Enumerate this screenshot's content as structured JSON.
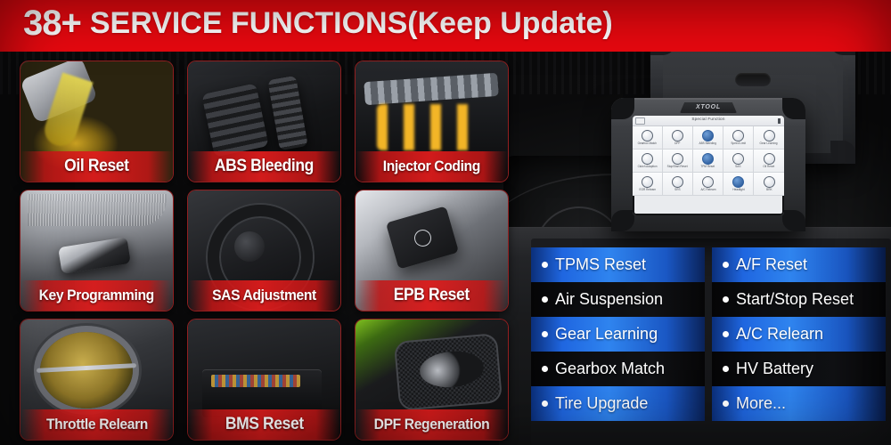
{
  "banner": {
    "number": "38+",
    "title": "SERVICE FUNCTIONS(Keep Update)",
    "background_color": "#e8080f",
    "text_color": "#ffffff"
  },
  "tiles": [
    {
      "label": "Oil Reset",
      "art": "ph-oil",
      "image_alt": "oil-pouring-into-engine"
    },
    {
      "label": "ABS Bleeding",
      "art": "ph-abs",
      "image_alt": "brake-pedals"
    },
    {
      "label": "Injector Coding",
      "art": "ph-inj",
      "image_alt": "fuel-injector-rail"
    },
    {
      "label": "Key Programming",
      "art": "ph-key",
      "image_alt": "car-key-fob"
    },
    {
      "label": "SAS Adjustment",
      "art": "ph-sas",
      "image_alt": "steering-wheel"
    },
    {
      "label": "EPB Reset",
      "art": "ph-epb",
      "image_alt": "electronic-parking-brake-switch"
    },
    {
      "label": "Throttle Relearn",
      "art": "ph-thr",
      "image_alt": "throttle-body"
    },
    {
      "label": "BMS Reset",
      "art": "ph-bms",
      "image_alt": "car-battery"
    },
    {
      "label": "DPF Regeneration",
      "art": "ph-dpf",
      "image_alt": "exhaust-tailpipes"
    }
  ],
  "device": {
    "brand": "XTOOL",
    "screen": {
      "title": "Special Function",
      "icons": [
        {
          "label": "Gearbox Match",
          "filled": false
        },
        {
          "label": "DPF",
          "filled": false
        },
        {
          "label": "ABS Bleeding",
          "filled": true
        },
        {
          "label": "Speed Limit",
          "filled": false
        },
        {
          "label": "Gear Learning",
          "filled": false
        },
        {
          "label": "Clutch Adaption",
          "filled": false
        },
        {
          "label": "Stop/Start Reset",
          "filled": false
        },
        {
          "label": "TPM Reset",
          "filled": true
        },
        {
          "label": "SAS",
          "filled": false
        },
        {
          "label": "Oil Reset",
          "filled": false
        },
        {
          "label": "EGR Relearn",
          "filled": false
        },
        {
          "label": "SRS",
          "filled": false
        },
        {
          "label": "A/C Relearn",
          "filled": false
        },
        {
          "label": "Headlight",
          "filled": true
        },
        {
          "label": "BRK",
          "filled": false
        }
      ]
    }
  },
  "function_list": {
    "accent_blue": "#2f84ef",
    "columns": [
      {
        "items": [
          {
            "label": "TPMS Reset",
            "highlight": true
          },
          {
            "label": "Air Suspension",
            "highlight": false
          },
          {
            "label": "Gear Learning",
            "highlight": true
          },
          {
            "label": "Gearbox Match",
            "highlight": false
          },
          {
            "label": "Tire Upgrade",
            "highlight": true
          }
        ]
      },
      {
        "items": [
          {
            "label": "A/F Reset",
            "highlight": true
          },
          {
            "label": "Start/Stop Reset",
            "highlight": false
          },
          {
            "label": "A/C Relearn",
            "highlight": true
          },
          {
            "label": "HV Battery",
            "highlight": false
          },
          {
            "label": "More...",
            "highlight": true
          }
        ]
      }
    ]
  }
}
